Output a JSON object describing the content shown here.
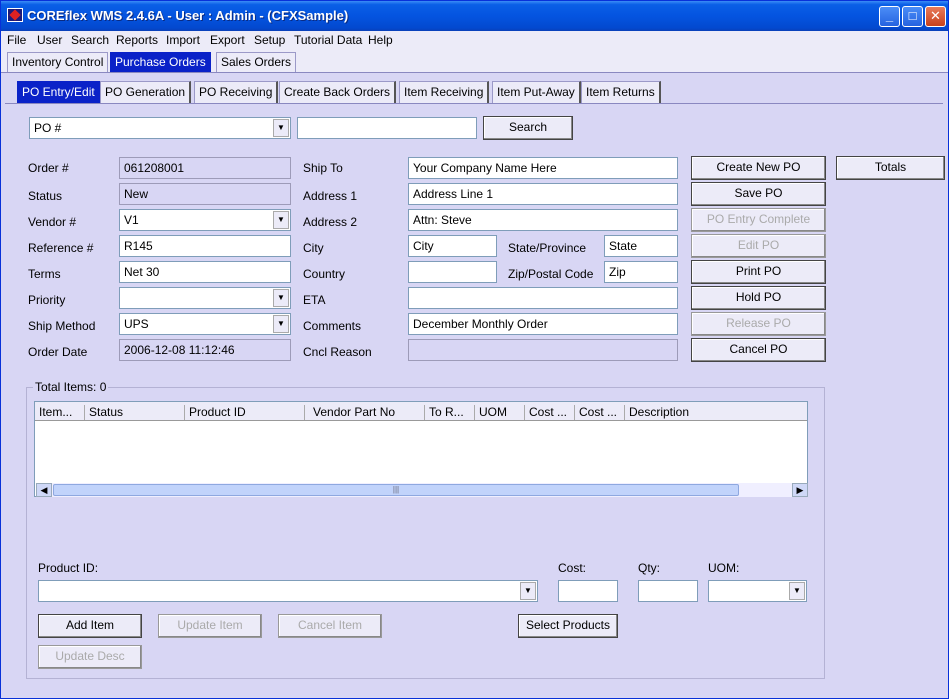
{
  "window": {
    "title": "COREflex WMS 2.4.6A - User : Admin - (CFXSample)"
  },
  "menu": [
    "File",
    "User",
    "Search",
    "Reports",
    "Import",
    "Export",
    "Setup",
    "Tutorial Data",
    "Help"
  ],
  "module_tabs": [
    "Inventory Control",
    "Purchase Orders",
    "Sales Orders"
  ],
  "sub_tabs": [
    "PO Entry/Edit",
    "PO Generation",
    "PO Receiving",
    "Create Back Orders",
    "Item Receiving",
    "Item Put-Away",
    "Item Returns"
  ],
  "search": {
    "field_selected": "PO #",
    "value": "",
    "button": "Search"
  },
  "form": {
    "order_label": "Order #",
    "order_value": "061208001",
    "status_label": "Status",
    "status_value": "New",
    "vendor_label": "Vendor #",
    "vendor_value": "V1",
    "reference_label": "Reference #",
    "reference_value": "R145",
    "terms_label": "Terms",
    "terms_value": "Net 30",
    "priority_label": "Priority",
    "priority_value": "",
    "ship_method_label": "Ship Method",
    "ship_method_value": "UPS",
    "order_date_label": "Order Date",
    "order_date_value": "2006-12-08 11:12:46",
    "ship_to_label": "Ship To",
    "ship_to_value": "Your Company Name Here",
    "address1_label": "Address 1",
    "address1_value": "Address Line 1",
    "address2_label": "Address 2",
    "address2_value": "Attn: Steve",
    "city_label": "City",
    "city_value": "City",
    "state_label": "State/Province",
    "state_value": "State",
    "country_label": "Country",
    "country_value": "",
    "zip_label": "Zip/Postal Code",
    "zip_value": "Zip",
    "eta_label": "ETA",
    "eta_value": "",
    "comments_label": "Comments",
    "comments_value": "December Monthly Order",
    "cncl_label": "Cncl Reason",
    "cncl_value": ""
  },
  "actions": {
    "create": "Create New PO",
    "save": "Save PO",
    "complete": "PO Entry Complete",
    "edit": "Edit PO",
    "print": "Print PO",
    "hold": "Hold PO",
    "release": "Release PO",
    "cancel": "Cancel PO",
    "totals": "Totals"
  },
  "items": {
    "legend": "Total Items: 0",
    "columns": [
      "Item...",
      "Status",
      "Product ID",
      "Vendor Part No",
      "To R...",
      "UOM",
      "Cost ...",
      "Cost ...",
      "Description"
    ],
    "product_label": "Product ID:",
    "product_value": "",
    "cost_label": "Cost:",
    "cost_value": "",
    "qty_label": "Qty:",
    "qty_value": "",
    "uom_label": "UOM:",
    "uom_value": "",
    "add": "Add Item",
    "update": "Update Item",
    "cancel": "Cancel Item",
    "select": "Select Products",
    "update_desc": "Update Desc"
  }
}
